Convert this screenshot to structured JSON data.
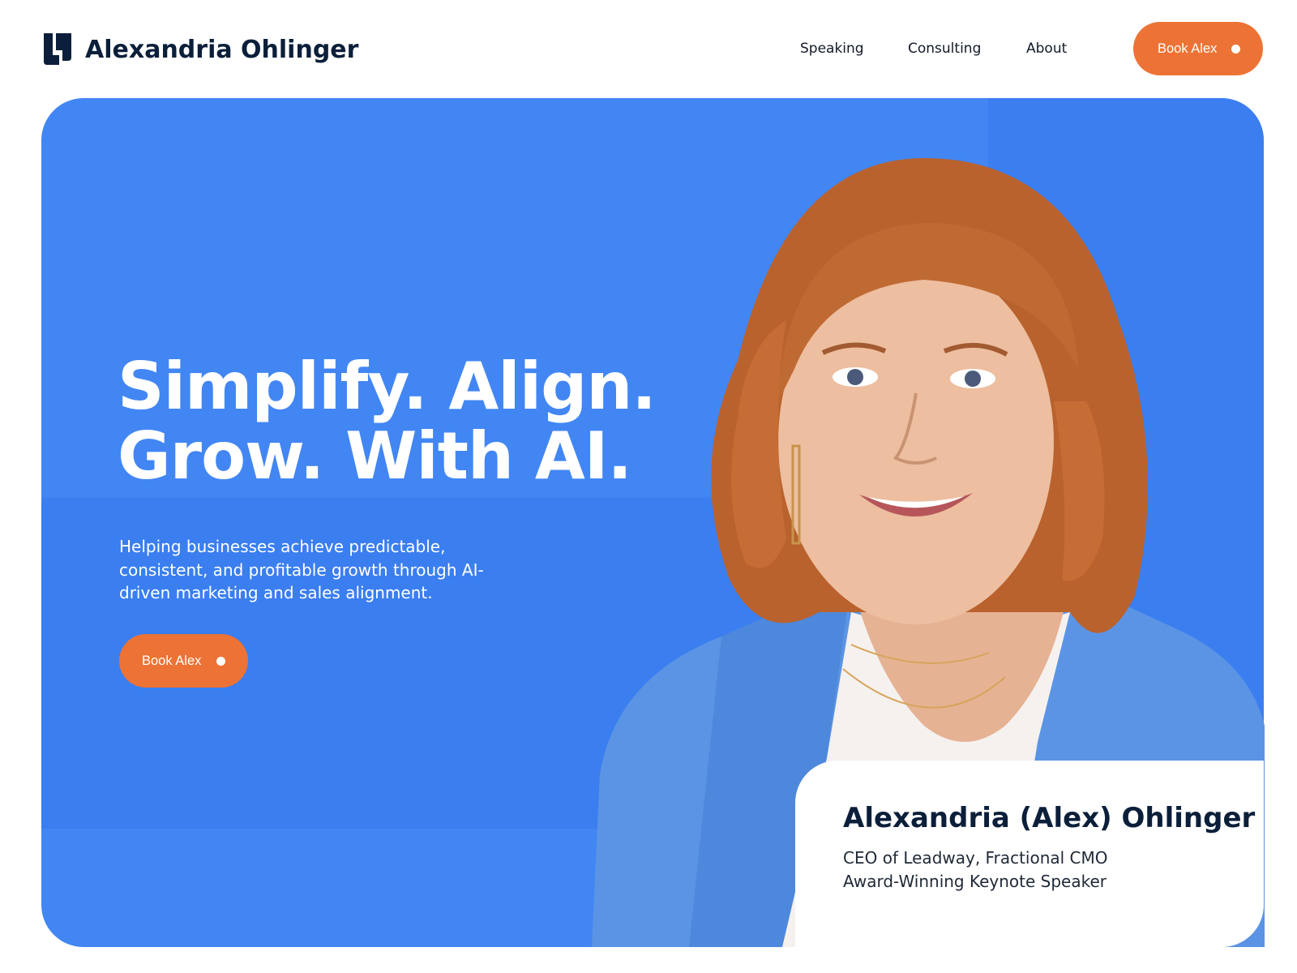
{
  "header": {
    "brand_name": "Alexandria Ohlinger",
    "logo_icon": "ao-monogram-icon",
    "nav": [
      {
        "label": "Speaking"
      },
      {
        "label": "Consulting"
      },
      {
        "label": "About"
      }
    ],
    "cta_label": "Book Alex"
  },
  "hero": {
    "headline_line1": "Simplify. Align.",
    "headline_line2": "Grow. With AI.",
    "subtext": "Helping businesses achieve predictable, consistent, and profitable growth through AI-driven marketing and sales alignment.",
    "cta_label": "Book Alex",
    "background_color": "#4286f3",
    "accent_color": "#ec7335"
  },
  "profile_card": {
    "name": "Alexandria (Alex) Ohlinger",
    "title_line1": "CEO of Leadway, Fractional CMO",
    "title_line2": "Award-Winning Keynote Speaker"
  },
  "portrait": {
    "subject": "portrait of Alexandria Ohlinger"
  }
}
